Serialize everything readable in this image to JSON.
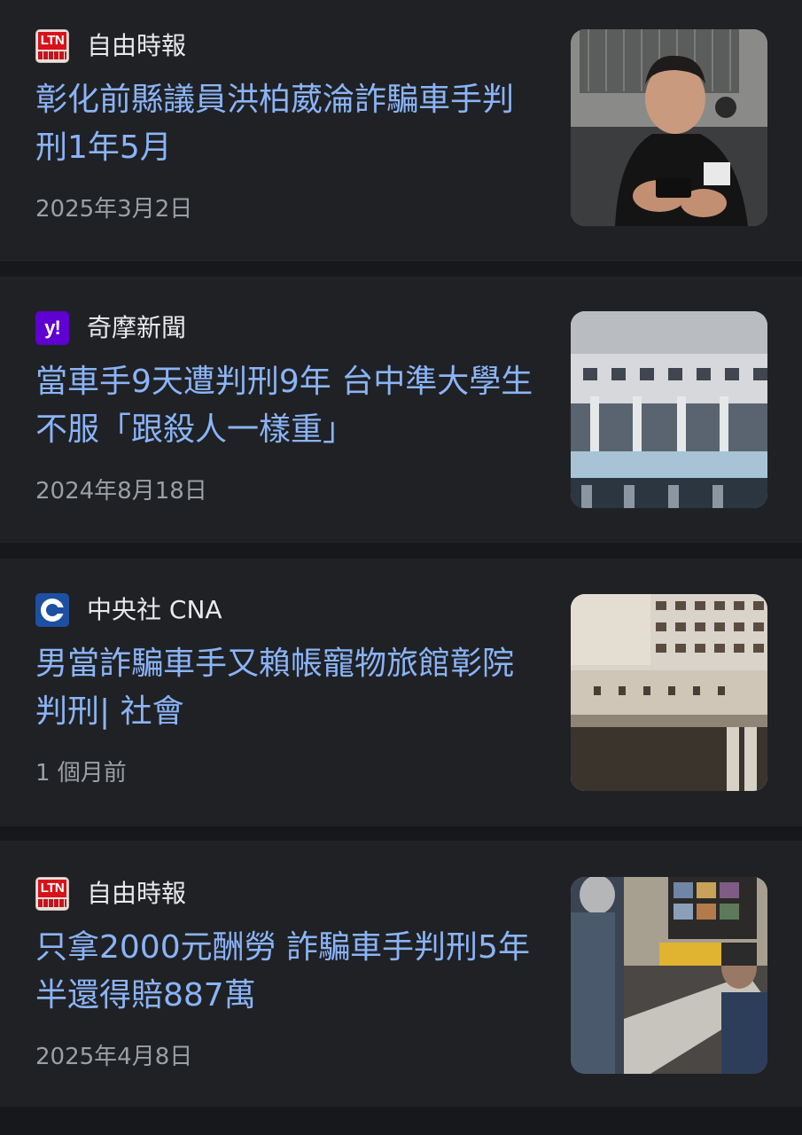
{
  "articles": [
    {
      "source": "自由時報",
      "logo_icon": "ltn-logo-icon",
      "logo_text": "LTN",
      "headline": "彰化前縣議員洪柏葳淪詐騙車手判刑1年5月",
      "date": "2025年3月2日",
      "thumbnail": "man-using-phone-thumbnail"
    },
    {
      "source": "奇摩新聞",
      "logo_icon": "yahoo-logo-icon",
      "logo_text": "y!",
      "headline": "當車手9天遭判刑9年 台中準大學生不服「跟殺人一樣重」",
      "date": "2024年8月18日",
      "thumbnail": "courthouse-building-thumbnail"
    },
    {
      "source": "中央社 CNA",
      "logo_icon": "cna-logo-icon",
      "logo_text": "",
      "headline": "男當詐騙車手又賴帳寵物旅館彰院判刑| 社會",
      "date": "1 個月前",
      "thumbnail": "changhua-court-facade-thumbnail"
    },
    {
      "source": "自由時報",
      "logo_icon": "ltn-logo-icon",
      "logo_text": "LTN",
      "headline": "只拿2000元酬勞 詐騙車手判刑5年半還得賠887萬",
      "date": "2025年4月8日",
      "thumbnail": "police-station-interior-thumbnail"
    }
  ],
  "colors": {
    "background": "#17181b",
    "card": "#202124",
    "headline": "#8ab4f8",
    "source": "#e8eaed",
    "date": "#9aa0a6"
  }
}
